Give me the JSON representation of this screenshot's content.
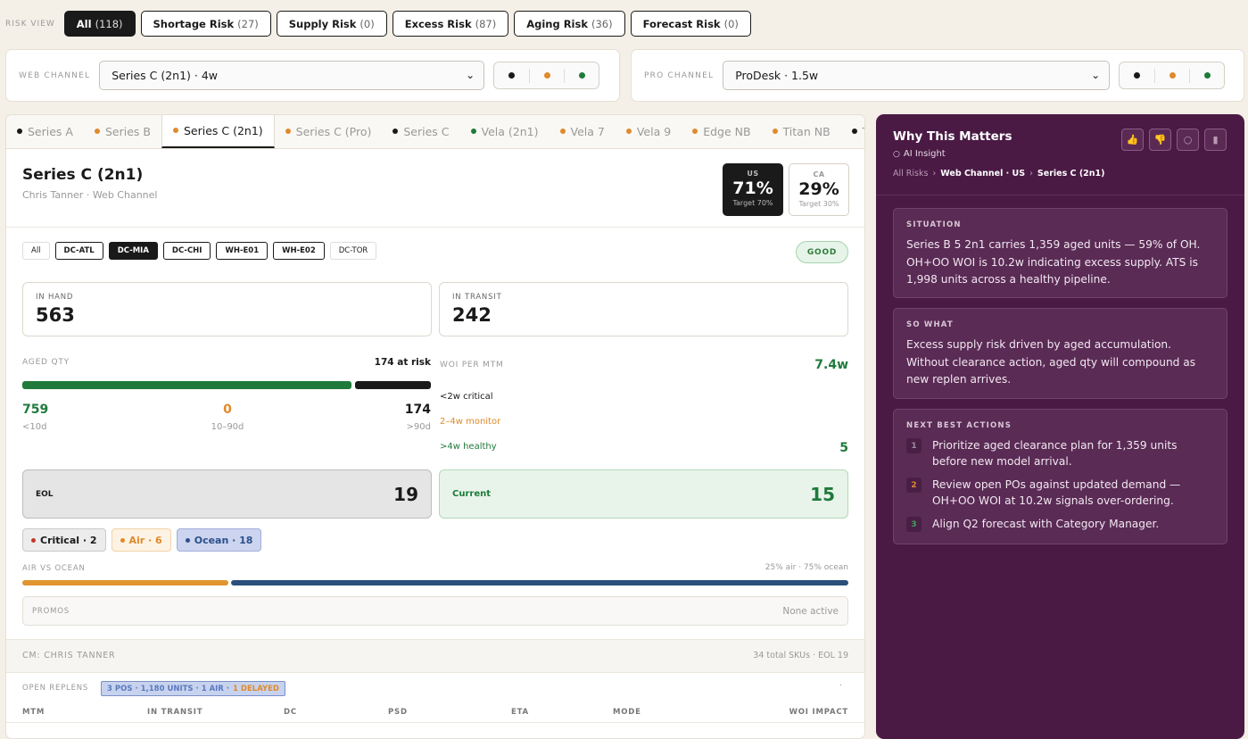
{
  "risk_view": {
    "label": "RISK VIEW",
    "filters": [
      {
        "label": "All",
        "count": "(118)",
        "active": true
      },
      {
        "label": "Shortage Risk",
        "count": "(27)"
      },
      {
        "label": "Supply Risk",
        "count": "(0)"
      },
      {
        "label": "Excess Risk",
        "count": "(87)"
      },
      {
        "label": "Aging Risk",
        "count": "(36)"
      },
      {
        "label": "Forecast Risk",
        "count": "(0)"
      }
    ]
  },
  "web_channel": {
    "label": "WEB CHANNEL",
    "selected": "Series C (2n1) · 4w"
  },
  "pro_channel": {
    "label": "PRO CHANNEL",
    "selected": "ProDesk · 1.5w"
  },
  "status_colors": {
    "black": "#1a1a1a",
    "orange": "#e08a2b",
    "green": "#1f7a3b"
  },
  "product_tabs": [
    {
      "label": "Series A",
      "color": "#1a1a1a"
    },
    {
      "label": "Series B",
      "color": "#e08a2b"
    },
    {
      "label": "Series C (2n1)",
      "color": "#e08a2b",
      "active": true
    },
    {
      "label": "Series C (Pro)",
      "color": "#e08a2b"
    },
    {
      "label": "Series C",
      "color": "#1a1a1a"
    },
    {
      "label": "Vela (2n1)",
      "color": "#1f7a3b"
    },
    {
      "label": "Vela 7",
      "color": "#e08a2b"
    },
    {
      "label": "Vela 9",
      "color": "#e08a2b"
    },
    {
      "label": "Edge NB",
      "color": "#e08a2b"
    },
    {
      "label": "Titan NB",
      "color": "#e08a2b"
    },
    {
      "label": "T",
      "color": "#1a1a1a"
    }
  ],
  "product": {
    "title": "Series C (2n1)",
    "subtitle": "Chris Tanner · Web Channel",
    "markets": [
      {
        "code": "US",
        "pct": "71%",
        "target": "Target 70%"
      },
      {
        "code": "CA",
        "pct": "29%",
        "target": "Target 30%"
      }
    ]
  },
  "dc_filters": [
    "All",
    "DC-ATL",
    "DC-MIA",
    "DC-CHI",
    "WH-E01",
    "WH-E02",
    "DC-TOR"
  ],
  "health_badge": "GOOD",
  "in_hand": {
    "label": "IN HAND",
    "value": "563"
  },
  "in_transit": {
    "label": "IN TRANSIT",
    "value": "242"
  },
  "aged": {
    "label": "AGED QTY",
    "at_risk": "174 at risk",
    "bar_share_young": 0.81,
    "buckets": [
      {
        "value": "759",
        "label": "<10d"
      },
      {
        "value": "0",
        "label": "10–90d"
      },
      {
        "value": "174",
        "label": ">90d"
      }
    ]
  },
  "woi": {
    "label": "WOI PER MTM",
    "value": "7.4w",
    "levels": [
      {
        "label": "<2w critical",
        "count": ""
      },
      {
        "label": "2–4w monitor",
        "count": ""
      },
      {
        "label": ">4w healthy",
        "count": "5"
      }
    ]
  },
  "eol": {
    "label": "EOL",
    "value": "19"
  },
  "current": {
    "label": "Current",
    "value": "15"
  },
  "pills": [
    {
      "label": "Critical · 2",
      "color": "#c0392b"
    },
    {
      "label": "Air · 6",
      "color": "#e08a2b"
    },
    {
      "label": "Ocean · 18",
      "color": "#2b4f8a"
    }
  ],
  "air_ocean": {
    "label": "AIR VS OCEAN",
    "summary": "25% air · 75% ocean",
    "air_share": 0.25
  },
  "promos": {
    "label": "PROMOS",
    "value": "None active"
  },
  "cm": {
    "label": "CM: CHRIS TANNER",
    "summary": "34 total SKUs · EOL 19"
  },
  "replens": {
    "label": "OPEN REPLENS",
    "badge_main": "3 POS · 1,180 UNITS · 1 AIR ·",
    "badge_alert": "1 DELAYED",
    "columns": [
      "MTM",
      "IN TRANSIT",
      "DC",
      "PSD",
      "ETA",
      "MODE",
      "WOI IMPACT"
    ]
  },
  "insight": {
    "title": "Why This Matters",
    "subtitle": "AI Insight",
    "breadcrumb": [
      "All Risks",
      "Web Channel · US",
      "Series C (2n1)"
    ],
    "situation_label": "SITUATION",
    "situation": "Series B 5 2n1 carries 1,359 aged units — 59% of OH. OH+OO WOI is 10.2w indicating excess supply. ATS is 1,998 units across a healthy pipeline.",
    "sowhat_label": "SO WHAT",
    "sowhat": "Excess supply risk driven by aged accumulation. Without clearance action, aged qty will compound as new replen arrives.",
    "actions_label": "NEXT BEST ACTIONS",
    "actions": [
      {
        "n": "1",
        "text": "Prioritize aged clearance plan for 1,359 units before new model arrival.",
        "color": "#9b8fa0"
      },
      {
        "n": "2",
        "text": "Review open POs against updated demand — OH+OO WOI at 10.2w signals over-ordering.",
        "color": "#e08a2b"
      },
      {
        "n": "3",
        "text": "Align Q2 forecast with Category Manager.",
        "color": "#3fa35b"
      }
    ]
  }
}
